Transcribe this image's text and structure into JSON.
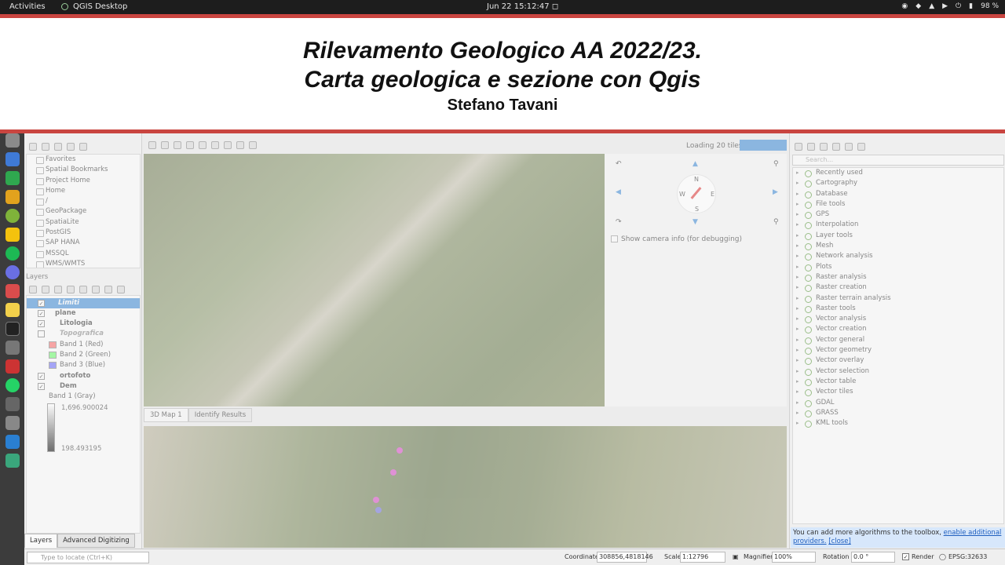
{
  "topbar": {
    "activities": "Activities",
    "app_name": "QGIS Desktop",
    "datetime": "Jun 22  15:12:47",
    "battery": "98 %"
  },
  "banner": {
    "line1": "Rilevamento Geologico AA 2022/23.",
    "line2": "Carta geologica e sezione con Qgis",
    "author": "Stefano Tavani"
  },
  "browser": {
    "items": [
      "Favorites",
      "Spatial Bookmarks",
      "Project Home",
      "Home",
      "/",
      "GeoPackage",
      "SpatiaLite",
      "PostGIS",
      "SAP HANA",
      "MSSQL",
      "WMS/WMTS"
    ]
  },
  "layers": {
    "title": "Layers",
    "items": [
      {
        "label": "Limiti",
        "checked": true
      },
      {
        "label": "plane",
        "checked": true
      },
      {
        "label": "Litologia",
        "checked": true
      },
      {
        "label": "Topografica",
        "checked": false
      },
      {
        "label": "Band 1 (Red)",
        "color": "#ff6b6b"
      },
      {
        "label": "Band 2 (Green)",
        "color": "#6bff6b"
      },
      {
        "label": "Band 3 (Blue)",
        "color": "#6b6bff"
      },
      {
        "label": "ortofoto",
        "checked": true
      },
      {
        "label": "Dem",
        "checked": true
      },
      {
        "label": "Band 1 (Gray)"
      }
    ],
    "dem_max": "1,696.900024",
    "dem_min": "198.493195"
  },
  "left_tabs": [
    "Layers",
    "Advanced Digitizing"
  ],
  "map3d": {
    "loading": "Loading 20 tiles",
    "compass": {
      "n": "N",
      "s": "S",
      "e": "E",
      "w": "W"
    },
    "camera_info": "Show camera info (for debugging)"
  },
  "mid_tabs": [
    "3D Map 1",
    "Identify Results"
  ],
  "processing": {
    "search_placeholder": "Search...",
    "items": [
      "Recently used",
      "Cartography",
      "Database",
      "File tools",
      "GPS",
      "Interpolation",
      "Layer tools",
      "Mesh",
      "Network analysis",
      "Plots",
      "Raster analysis",
      "Raster creation",
      "Raster terrain analysis",
      "Raster tools",
      "Vector analysis",
      "Vector creation",
      "Vector general",
      "Vector geometry",
      "Vector overlay",
      "Vector selection",
      "Vector table",
      "Vector tiles",
      "GDAL",
      "GRASS",
      "KML tools"
    ],
    "banner_text": "You can add more algorithms to the toolbox,",
    "banner_link": "enable additional providers.",
    "banner_close": "[close]"
  },
  "statusbar": {
    "locate_placeholder": "Type to locate (Ctrl+K)",
    "coordinate_label": "Coordinate",
    "coordinate_value": "308856,4818146",
    "scale_label": "Scale",
    "scale_value": "1:12796",
    "magnifier_label": "Magnifier",
    "magnifier_value": "100%",
    "rotation_label": "Rotation",
    "rotation_value": "0.0 °",
    "render_label": "Render",
    "crs": "EPSG:32633"
  }
}
